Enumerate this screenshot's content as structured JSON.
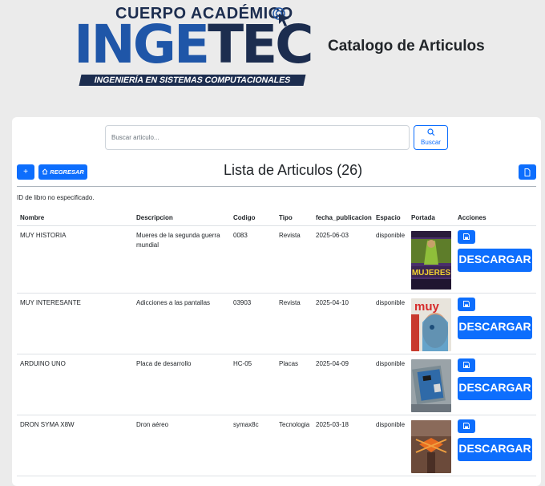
{
  "header": {
    "logo": {
      "top_text": "CUERPO ACADÉMICO",
      "main_text_1": "IN",
      "main_text_2": "GE",
      "main_text_3": "TEC",
      "band_text": "INGENIERÍA EN SISTEMAS COMPUTACIONALES"
    },
    "page_title": "Catalogo de Articulos"
  },
  "search": {
    "placeholder": "Buscar articulo...",
    "button_label": "Buscar",
    "button_icon": "search-icon"
  },
  "toolbar": {
    "add_label": "+",
    "back_label": "REGRESAR",
    "back_icon": "home-icon",
    "report_icon": "document-icon",
    "list_title": "Lista de Articulos (26)"
  },
  "status_message": "ID de libro no especificado.",
  "table": {
    "columns": [
      "Nombre",
      "Descripcion",
      "Codigo",
      "Tipo",
      "fecha_publicacion",
      "Espacio",
      "Portada",
      "Acciones"
    ],
    "rows": [
      {
        "nombre": "MUY HISTORIA",
        "descripcion": "Mueres de la segunda guerra mundial",
        "codigo": "0083",
        "tipo": "Revista",
        "fecha": "2025-06-03",
        "espacio": "disponible",
        "portada": "mujeres-magazine-cover",
        "cover_text": "MUJERES",
        "download_label": "DESCARGAR"
      },
      {
        "nombre": "MUY INTERESANTE",
        "descripcion": "Adicciones a las pantallas",
        "codigo": "03903",
        "tipo": "Revista",
        "fecha": "2025-04-10",
        "espacio": "disponible",
        "portada": "muy-magazine-cover",
        "cover_text": "muy",
        "download_label": "DESCARGAR"
      },
      {
        "nombre": "ARDUINO UNO",
        "descripcion": "Placa de desarrollo",
        "codigo": "HC-05",
        "tipo": "Placas",
        "fecha": "2025-04-09",
        "espacio": "disponible",
        "portada": "arduino-board-photo",
        "download_label": "DESCARGAR"
      },
      {
        "nombre": "DRON SYMA X8W",
        "descripcion": "Dron aéreo",
        "codigo": "symax8c",
        "tipo": "Tecnologia",
        "fecha": "2025-03-18",
        "espacio": "disponible",
        "portada": "drone-photo",
        "download_label": "DESCARGAR"
      }
    ]
  },
  "colors": {
    "primary": "#0d6efd",
    "logo_blue": "#1f56a8",
    "logo_dark": "#1c2d4f",
    "page_background": "#ebebeb"
  }
}
